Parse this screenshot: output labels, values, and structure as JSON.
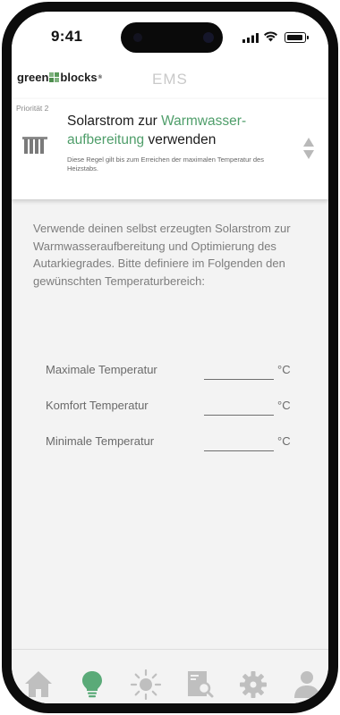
{
  "status_bar": {
    "time": "9:41"
  },
  "header": {
    "logo_part1": "green",
    "logo_part2": "blocks",
    "logo_reg": "®",
    "title": "EMS"
  },
  "rule_card": {
    "priority": "Priorität 2",
    "title_part1": "Solarstrom zur ",
    "title_highlight": "Warmwasser-aufbereitung",
    "title_part2": " verwenden",
    "description": "Diese Regel gilt bis zum Erreichen der maximalen Temperatur des Heizstabs.",
    "icon": "radiator-icon"
  },
  "intro_text": "Verwende deinen selbst erzeugten Solarstrom zur Warmwasseraufbereitung und Optimierung des Autarkiegrades. Bitte definiere im Folgenden den gewünschten Temperaturbereich:",
  "temperatures": [
    {
      "label": "Maximale Temperatur",
      "value": "",
      "unit": "°C"
    },
    {
      "label": "Komfort Temperatur",
      "value": "",
      "unit": "°C"
    },
    {
      "label": "Minimale Temperatur",
      "value": "",
      "unit": "°C"
    }
  ],
  "bottom_nav": [
    {
      "icon": "home-icon",
      "active": false
    },
    {
      "icon": "lightbulb-icon",
      "active": true
    },
    {
      "icon": "sun-icon",
      "active": false
    },
    {
      "icon": "report-search-icon",
      "active": false
    },
    {
      "icon": "gear-icon",
      "active": false
    },
    {
      "icon": "user-icon",
      "active": false
    }
  ],
  "colors": {
    "accent_green": "#4f9e6a",
    "nav_inactive": "#bfbfbf",
    "nav_active": "#5aaa78"
  }
}
